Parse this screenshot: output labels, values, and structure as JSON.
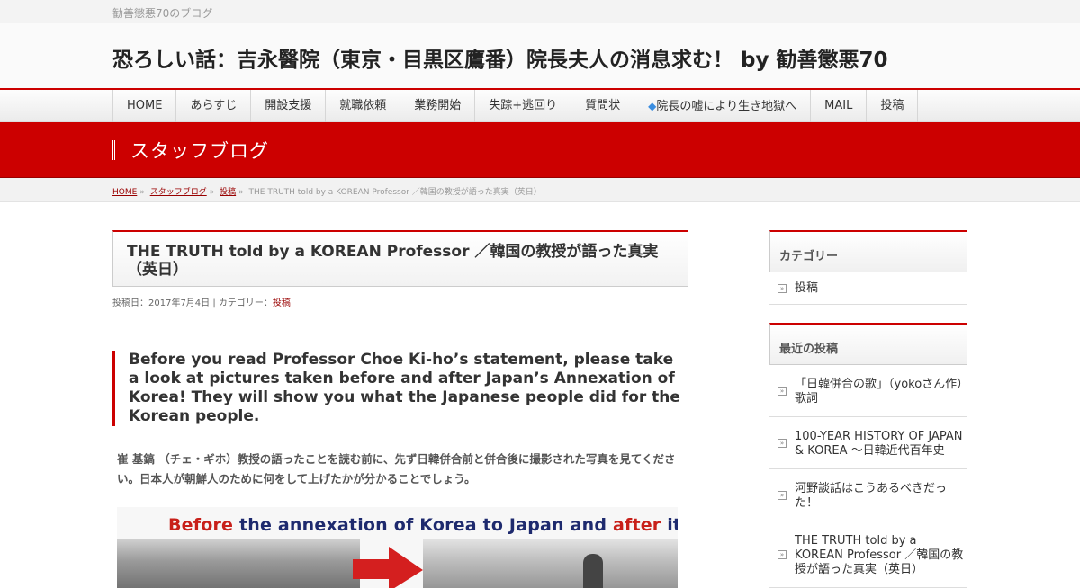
{
  "topbar": {
    "tagline": "勧善懲悪70のブログ"
  },
  "header": {
    "site_title": "恐ろしい話：吉永醫院（東京・目黒区鷹番）院長夫人の消息求む！ by 勧善懲悪70"
  },
  "nav": {
    "items": [
      {
        "label": "HOME"
      },
      {
        "label": "あらすじ"
      },
      {
        "label": "開設支援"
      },
      {
        "label": "就職依頼"
      },
      {
        "label": "業務開始"
      },
      {
        "label": "失踪+逃回り"
      },
      {
        "label": "質問状"
      },
      {
        "label": "院長の嘘により生き地獄へ",
        "icon": "blue-diamond-icon"
      },
      {
        "label": "MAIL"
      },
      {
        "label": "投稿"
      }
    ]
  },
  "section": {
    "title": "スタッフブログ"
  },
  "breadcrumb": {
    "home": "HOME",
    "sep": "»",
    "blog": "スタッフブログ",
    "category": "投稿",
    "current": "THE TRUTH told by a KOREAN Professor ／韓国の教授が語った真実（英日）"
  },
  "post": {
    "title": "THE TRUTH told by a KOREAN Professor ／韓国の教授が語った真実（英日）",
    "meta_prefix": "投稿日：2017年7月4日 | カテゴリー：",
    "meta_category": "投稿",
    "quote": "Before you read Professor Choe Ki-ho’s statement, please take a look at pictures taken before and after Japan’s Annexation of Korea!  They will show you what the Japanese people did for the Korean people.",
    "jp_text": "崔 基鎬 （チェ・ギホ）教授の語ったことを読む前に、先ず日韓併合前と併合後に撮影された写真を見てください。日本人が朝鮮人のために何をして上げたかが分かることでしょう。",
    "image_caption_before": "Before",
    "image_caption_middle": " the annexation of Korea to Japan and ",
    "image_caption_after": "after",
    "image_caption_end": " it"
  },
  "sidebar": {
    "categories_title": "カテゴリー",
    "categories": [
      {
        "label": "投稿"
      }
    ],
    "recent_title": "最近の投稿",
    "recent": [
      {
        "label": "「日韓併合の歌」（yokoさん作）歌詞"
      },
      {
        "label": "100-YEAR HISTORY OF JAPAN & KOREA ～日韓近代百年史"
      },
      {
        "label": "河野談話はこうあるべきだった！"
      },
      {
        "label": "THE TRUTH told by a KOREAN Professor ／韓国の教授が語った真実（英日）"
      }
    ]
  },
  "colors": {
    "accent": "#cc0000",
    "link": "#990000",
    "nav_diamond": "#3a8de0"
  }
}
